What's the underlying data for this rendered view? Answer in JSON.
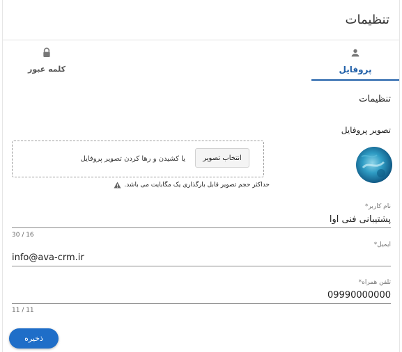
{
  "page": {
    "title": "تنظیمات"
  },
  "tabs": [
    {
      "label": "پروفایل",
      "icon": "person-icon",
      "active": true
    },
    {
      "label": "کلمه عبور",
      "icon": "lock-icon",
      "active": false
    }
  ],
  "section": {
    "title": "تنظیمات"
  },
  "avatar": {
    "label": "تصویر پروفایل"
  },
  "upload": {
    "button_label": "انتخاب تصویر",
    "drop_text": "یا کشیدن و رها کردن تصویر پروفایل",
    "warning": "حداکثر حجم تصویر قابل بارگذاری یک مگابایت می باشد."
  },
  "fields": {
    "username": {
      "label": "نام کاربر*",
      "value": "پشتیبانی فنی آوا",
      "counter": "30 / 16"
    },
    "email": {
      "label": "ایمیل*",
      "value": "info@ava-crm.ir"
    },
    "phone": {
      "label": "تلفن همراه*",
      "value": "09990000000",
      "counter": "11 / 11"
    }
  },
  "actions": {
    "save_label": "ذخیره"
  },
  "colors": {
    "accent": "#1f5fa8",
    "button": "#1f6ec8"
  }
}
